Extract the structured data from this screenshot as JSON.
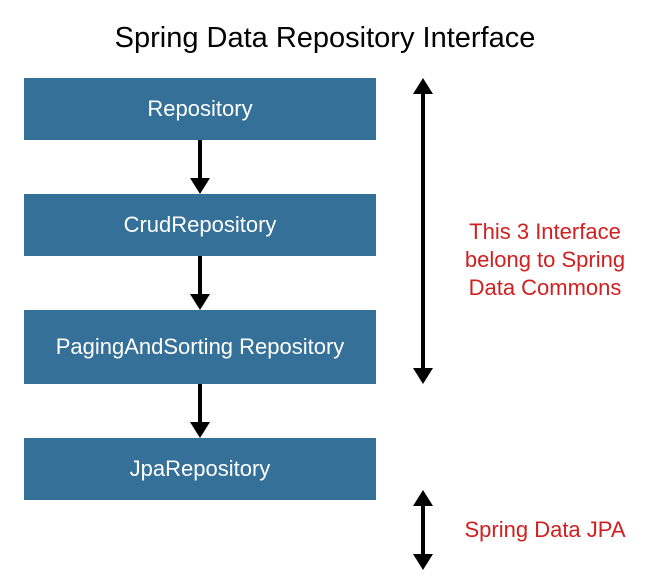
{
  "title": "Spring Data Repository Interface",
  "boxes": {
    "repository": "Repository",
    "crud": "CrudRepository",
    "paging": "PagingAndSorting Repository",
    "jpa": "JpaRepository"
  },
  "notes": {
    "commons": "This 3 Interface belong to Spring Data Commons",
    "jpa": "Spring Data JPA"
  }
}
